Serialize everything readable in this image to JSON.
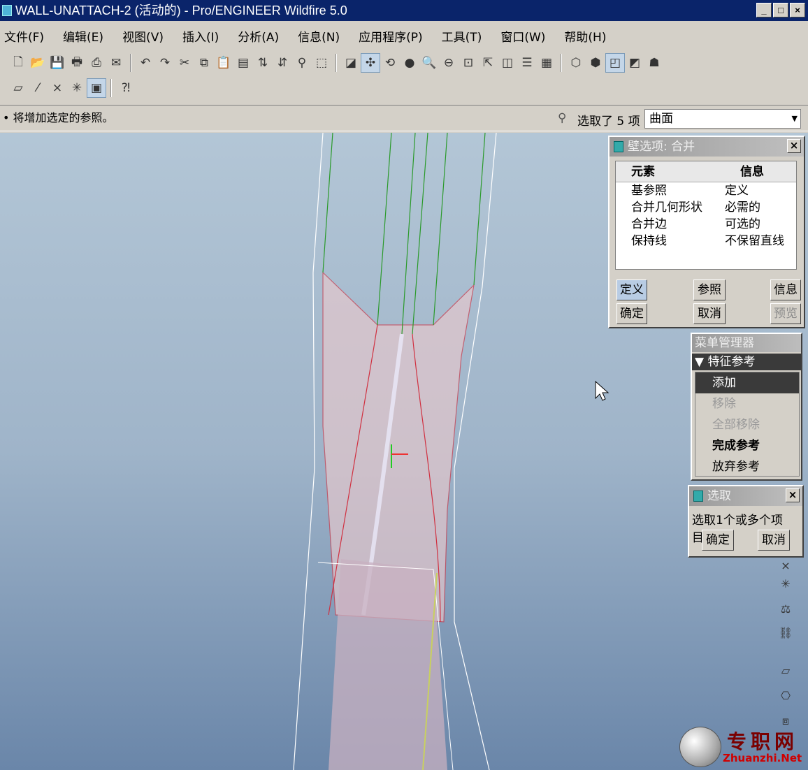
{
  "window": {
    "title": "WALL-UNATTACH-2 (活动的) - Pro/ENGINEER Wildfire 5.0",
    "buttons": [
      "_",
      "□",
      "×"
    ]
  },
  "menubar": [
    "文件(F)",
    "编辑(E)",
    "视图(V)",
    "插入(I)",
    "分析(A)",
    "信息(N)",
    "应用程序(P)",
    "工具(T)",
    "窗口(W)",
    "帮助(H)"
  ],
  "status": {
    "message": "• 将增加选定的参照。",
    "selection": "选取了 5 项",
    "filter": "曲面"
  },
  "wall_dialog": {
    "title": "壁选项: 合并",
    "columns": [
      "元素",
      "信息"
    ],
    "rows": [
      {
        "element": "基参照",
        "info": "定义"
      },
      {
        "element": "合并几何形状",
        "info": "必需的"
      },
      {
        "element": "合并边",
        "info": "可选的"
      },
      {
        "element": "保持线",
        "info": "不保留直线"
      }
    ],
    "buttons": {
      "define": "定义",
      "refs": "参照",
      "info": "信息",
      "ok": "确定",
      "cancel": "取消",
      "preview": "预览"
    }
  },
  "menu_manager": {
    "title": "菜单管理器",
    "section": "▼ 特征参考",
    "items": [
      "添加",
      "移除",
      "全部移除",
      "完成参考",
      "放弃参考"
    ]
  },
  "select_dialog": {
    "title": "选取",
    "prompt": "选取1个或多个项目。",
    "ok": "确定",
    "cancel": "取消"
  },
  "watermark": {
    "cn": "专职网",
    "url": "Zhuanzhi.Net"
  }
}
